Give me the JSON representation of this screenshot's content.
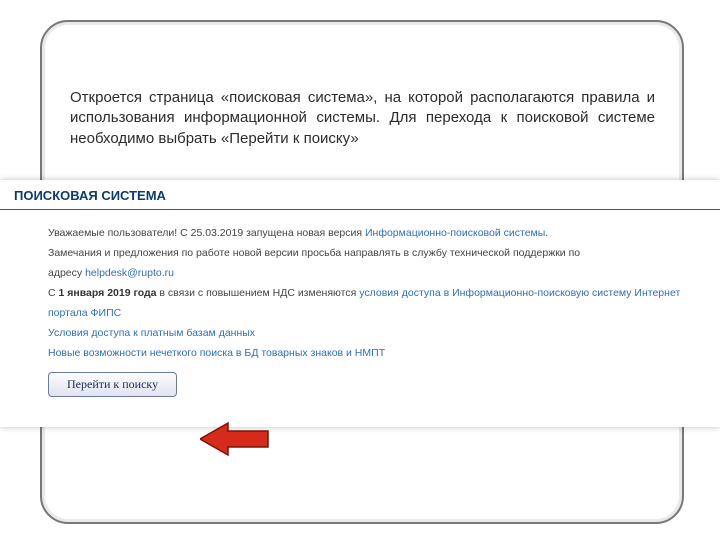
{
  "instruction": "Откроется страница «поисковая система», на которой располагаются правила и использования информационной системы. Для перехода к поисковой системе необходимо выбрать «Перейти к поиску»",
  "screenshot": {
    "title": "ПОИСКОВАЯ СИСТЕМА",
    "line1_a": "Уважаемые пользователи! С 25.03.2019 запущена новая версия ",
    "line1_link": "Информационно-поисковой системы",
    "line1_b": ".",
    "line2": "Замечания и предложения по работе новой версии просьба направлять в службу технической поддержки по",
    "line3_a": "адресу ",
    "line3_link": "helpdesk@rupto.ru",
    "line4_a": "С ",
    "line4_bold": "1 января 2019 года",
    "line4_b": " в связи с повышением НДС изменяются ",
    "line4_link": "условия доступа в Информационно-поисковую систему Интернет",
    "line5_link": "портала ФИПС",
    "line6_link": "Условия доступа к платным базам данных",
    "line7_link": "Новые возможности нечеткого поиска в БД товарных знаков и НМПТ",
    "button": "Перейти к поиску"
  }
}
